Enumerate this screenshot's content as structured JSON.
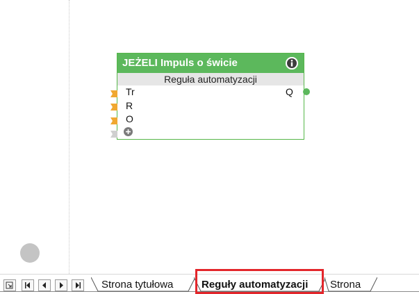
{
  "block": {
    "title": "JEŻELI Impuls o świcie",
    "subtitle": "Reguła automatyzacji",
    "inputs": [
      {
        "label": "Tr",
        "color": "#f0a830"
      },
      {
        "label": "R",
        "color": "#f0a830"
      },
      {
        "label": "O",
        "color": "#f0a830"
      }
    ],
    "outputs": [
      {
        "label": "Q",
        "color": "#5cb85c"
      }
    ],
    "header_color": "#5cb85c",
    "icons": {
      "info": "info-icon",
      "add": "add-input-icon"
    }
  },
  "tabs": {
    "nav_buttons": [
      "new-sheet-icon",
      "first-sheet-icon",
      "prev-sheet-icon",
      "next-sheet-icon",
      "last-sheet-icon"
    ],
    "items": [
      {
        "label": "Strona tytułowa",
        "active": false
      },
      {
        "label": "Reguły automatyzacji",
        "active": true
      },
      {
        "label": "Strona",
        "active": false
      }
    ],
    "highlight_color": "#e3262b"
  }
}
